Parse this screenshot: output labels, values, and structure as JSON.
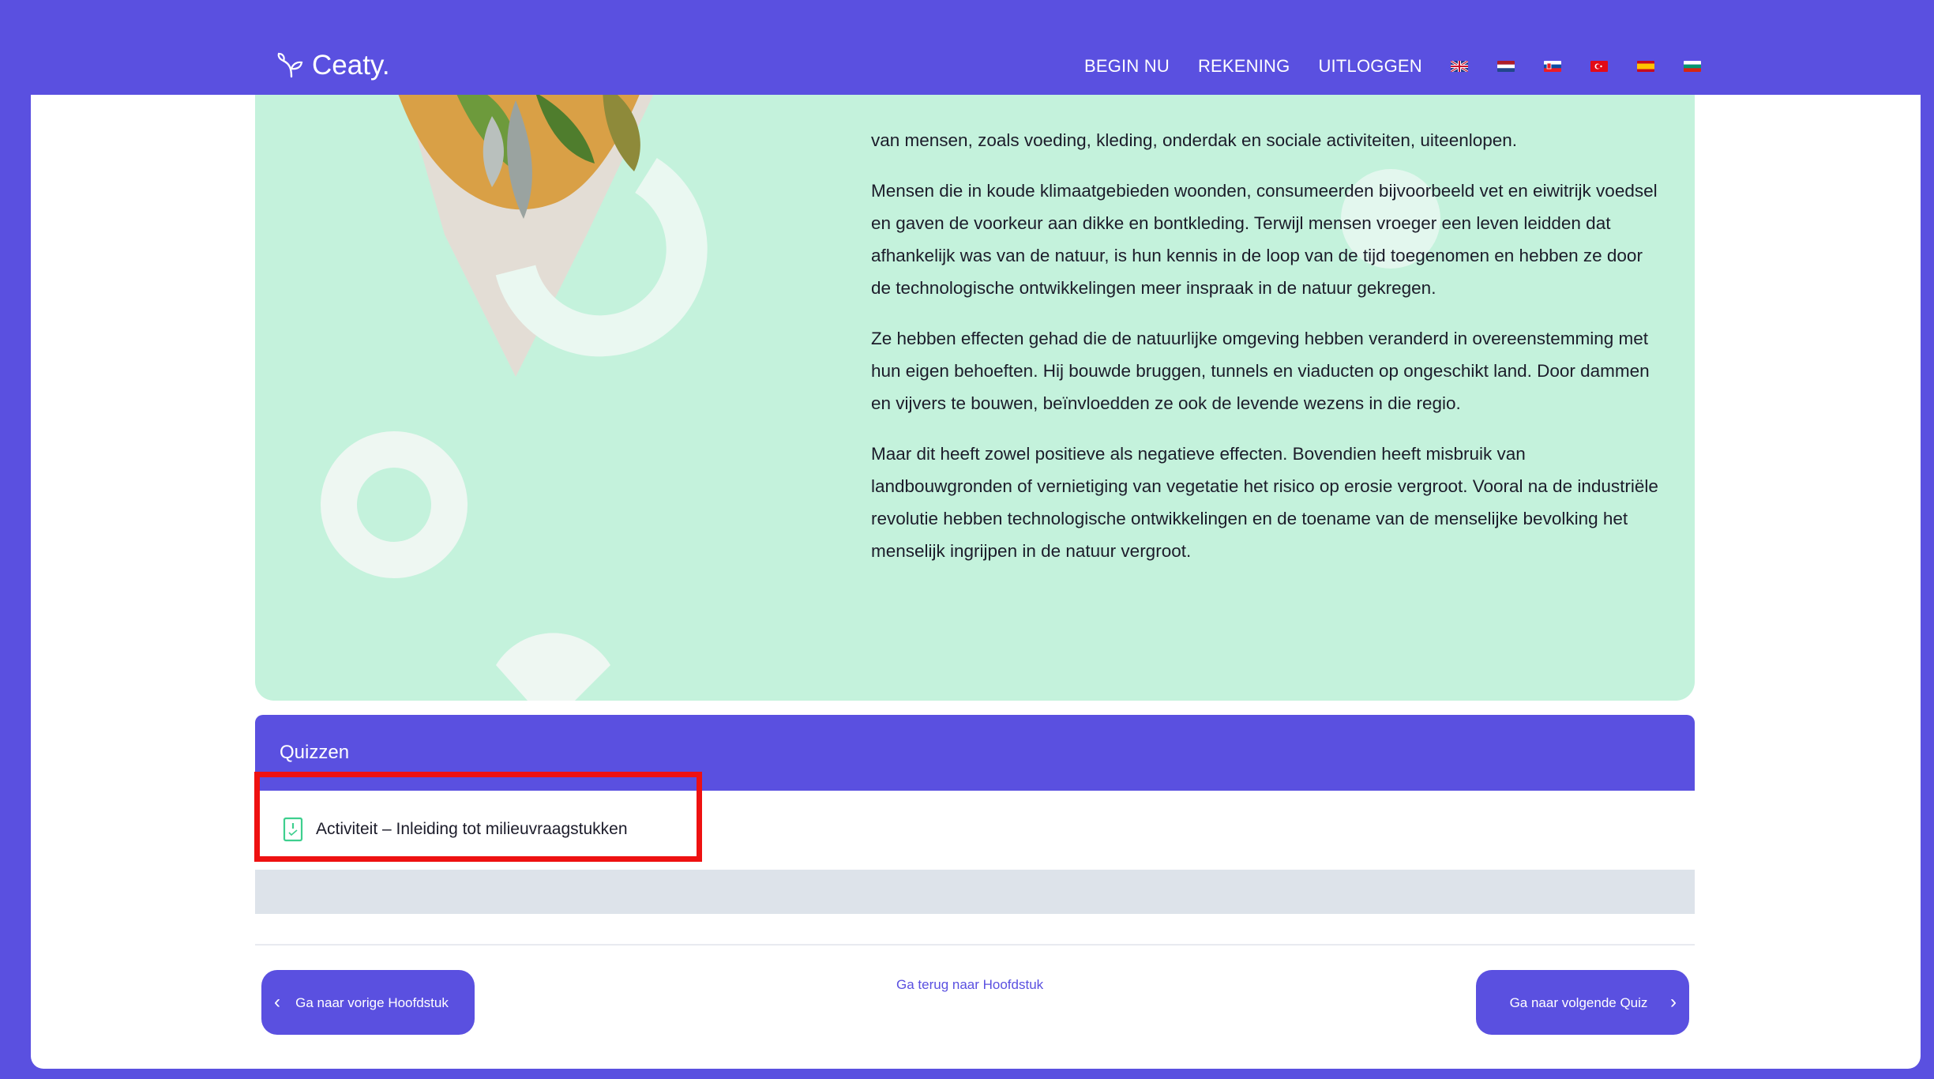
{
  "header": {
    "logo_text": "Ceaty.",
    "nav": [
      "BEGIN NU",
      "REKENING",
      "UITLOGGEN"
    ],
    "languages": [
      "English",
      "Dutch",
      "Slovak",
      "Turkish",
      "Spanish",
      "Bulgarian"
    ]
  },
  "content": {
    "paragraphs": [
      "van mensen, zoals voeding, kleding, onderdak en sociale activiteiten, uiteenlopen.",
      "Mensen die in koude klimaatgebieden woonden, consumeerden bijvoorbeeld vet en eiwitrijk voedsel en gaven de voorkeur aan dikke en bontkleding. Terwijl mensen vroeger een leven leidden dat afhankelijk was van de natuur, is hun kennis in de loop van de tijd toegenomen en hebben ze door de technologische ontwikkelingen meer inspraak in de natuur gekregen.",
      "Ze hebben effecten gehad die de natuurlijke omgeving hebben veranderd in overeenstemming met hun eigen behoeften. Hij bouwde bruggen, tunnels en viaducten op ongeschikt land. Door dammen en vijvers te bouwen, beïnvloedden ze ook de levende wezens in die regio.",
      "Maar dit heeft zowel positieve als negatieve effecten. Bovendien heeft misbruik van landbouwgronden of vernietiging van vegetatie het risico op erosie vergroot. Vooral na de industriële revolutie hebben technologische ontwikkelingen en de toename van de menselijke bevolking het menselijk ingrijpen in de natuur vergroot."
    ]
  },
  "quiz": {
    "title": "Quizzen",
    "items": [
      {
        "label": "Activiteit – Inleiding tot milieuvraagstukken",
        "icon": "quiz-document-icon"
      }
    ]
  },
  "footer_nav": {
    "prev_label": "Ga naar vorige Hoofdstuk",
    "back_label": "Ga terug naar Hoofdstuk",
    "next_label": "Ga naar volgende Quiz"
  },
  "colors": {
    "brand": "#5a50e0",
    "hero_bg": "#c4f2dc",
    "highlight": "#ee1111"
  }
}
